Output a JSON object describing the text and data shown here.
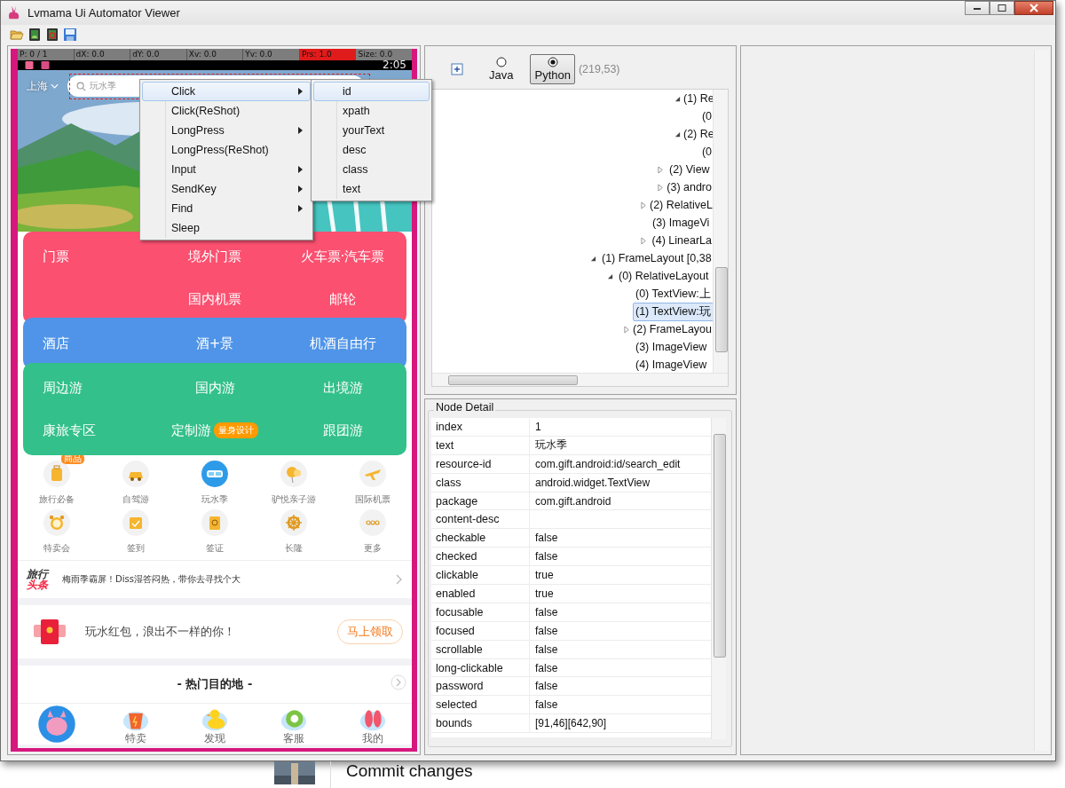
{
  "window": {
    "title": "Lvmama Ui Automator Viewer"
  },
  "phone": {
    "pointer_bar": [
      {
        "text": "P: 0 / 1",
        "alert": false
      },
      {
        "text": "dX: 0.0",
        "alert": false
      },
      {
        "text": "dY: 0.0",
        "alert": false
      },
      {
        "text": "Xv: 0.0",
        "alert": false
      },
      {
        "text": "Yv: 0.0",
        "alert": false
      },
      {
        "text": "Prs: 1.0",
        "alert": true
      },
      {
        "text": "Size: 0.0",
        "alert": false
      }
    ],
    "clock": "2:05",
    "city": "上海",
    "search_placeholder": "玩水季",
    "sections": [
      {
        "color": "#fb5070",
        "rows": [
          [
            {
              "label": "门票"
            },
            {
              "label": "境外门票"
            },
            {
              "label": "火车票·汽车票"
            }
          ],
          [
            {},
            {
              "label": "国内机票"
            },
            {
              "label": "邮轮"
            }
          ]
        ]
      },
      {
        "color": "#4f94e8",
        "rows": [
          [
            {
              "label": "酒店"
            },
            {
              "label": "酒+景"
            },
            {
              "label": "机酒自由行"
            }
          ]
        ]
      },
      {
        "color": "#33c08a",
        "rows": [
          [
            {
              "label": "周边游"
            },
            {
              "label": "国内游"
            },
            {
              "label": "出境游"
            }
          ],
          [
            {
              "label": "康旅专区"
            },
            {
              "label": "定制游",
              "badge": "量身设计"
            },
            {
              "label": "跟团游"
            }
          ]
        ]
      }
    ],
    "shortcuts": [
      {
        "label": "旅行必备",
        "badge": "商品"
      },
      {
        "label": "自驾游"
      },
      {
        "label": "玩水季"
      },
      {
        "label": "驴悦亲子游"
      },
      {
        "label": "国际机票"
      },
      {
        "label": "特卖会"
      },
      {
        "label": "签到"
      },
      {
        "label": "签证"
      },
      {
        "label": "长隆"
      },
      {
        "label": "更多"
      }
    ],
    "news": {
      "logo_top": "旅行",
      "logo_bottom": "头条",
      "headline": "梅雨季霸屏！Diss湿答闷热，带你去寻找个大"
    },
    "promo": {
      "text": "玩水红包，浪出不一样的你！",
      "button": "马上领取"
    },
    "hot": {
      "title": "- 热门目的地 -"
    },
    "nav": [
      {
        "selected": true
      },
      {
        "label": "特卖",
        "selected": false
      },
      {
        "label": "发现",
        "selected": false
      },
      {
        "label": "客服",
        "selected": false
      },
      {
        "label": "我的",
        "selected": false
      }
    ]
  },
  "context_menu": {
    "items": [
      {
        "label": "Click",
        "submenu": true,
        "selected": true
      },
      {
        "label": "Click(ReShot)",
        "submenu": false,
        "selected": false
      },
      {
        "label": "LongPress",
        "submenu": true,
        "selected": false
      },
      {
        "label": "LongPress(ReShot)",
        "submenu": false,
        "selected": false
      },
      {
        "label": "Input",
        "submenu": true,
        "selected": false
      },
      {
        "label": "SendKey",
        "submenu": true,
        "selected": false
      },
      {
        "label": "Find",
        "submenu": true,
        "selected": false
      },
      {
        "label": "Sleep",
        "submenu": false,
        "selected": false
      }
    ],
    "submenu": [
      {
        "label": "id",
        "selected": true
      },
      {
        "label": "xpath",
        "selected": false
      },
      {
        "label": "yourText",
        "selected": false
      },
      {
        "label": "desc",
        "selected": false
      },
      {
        "label": "class",
        "selected": false
      },
      {
        "label": "text",
        "selected": false
      }
    ]
  },
  "hierarchy": {
    "languages": [
      {
        "label": "Java",
        "selected": false
      },
      {
        "label": "Python",
        "selected": true
      }
    ],
    "coordinates": "(219,53)",
    "tree": [
      {
        "children": [
          {
            "children": [
              {
                "children": [
                  {
                    "children": [
                      {
                        "children": [
                          {
                            "label": "(1) Re",
                            "expanded": true,
                            "selected": false,
                            "children": [
                              {
                                "label": "(0",
                                "selected": false
                              }
                            ]
                          },
                          {
                            "label": "(2) Re",
                            "expanded": true,
                            "selected": false,
                            "children": [
                              {
                                "label": "(0",
                                "selected": false
                              }
                            ]
                          }
                        ]
                      },
                      {
                        "label": "(2) View",
                        "expanded": false,
                        "selected": false
                      },
                      {
                        "label": "(3) andro",
                        "expanded": false,
                        "selected": false
                      }
                    ]
                  },
                  {
                    "label": "(2) RelativeL",
                    "expanded": false,
                    "selected": false
                  },
                  {
                    "label": "(3) ImageVi",
                    "selected": false
                  },
                  {
                    "label": "(4) LinearLa",
                    "expanded": false,
                    "selected": false
                  }
                ]
              }
            ]
          }
        ]
      },
      {
        "label": "(1) FrameLayout [0,38",
        "expanded": true,
        "selected": false,
        "children": [
          {
            "label": "(0) RelativeLayout",
            "expanded": true,
            "selected": false,
            "children": [
              {
                "label": "(0) TextView:上",
                "selected": false
              },
              {
                "label": "(1) TextView:玩",
                "selected": true
              },
              {
                "label": "(2) FrameLayou",
                "expanded": false,
                "selected": false
              },
              {
                "label": "(3) ImageView",
                "selected": false
              },
              {
                "label": "(4) ImageView",
                "selected": false
              }
            ]
          }
        ]
      }
    ]
  },
  "node_detail": {
    "title": "Node Detail",
    "rows": [
      {
        "key": "index",
        "value": "1"
      },
      {
        "key": "text",
        "value": "玩水季"
      },
      {
        "key": "resource-id",
        "value": "com.gift.android:id/search_edit"
      },
      {
        "key": "class",
        "value": "android.widget.TextView"
      },
      {
        "key": "package",
        "value": "com.gift.android"
      },
      {
        "key": "content-desc"
      },
      {
        "key": "checkable",
        "value": "false"
      },
      {
        "key": "checked",
        "value": "false"
      },
      {
        "key": "clickable",
        "value": "true"
      },
      {
        "key": "enabled",
        "value": "true"
      },
      {
        "key": "focusable",
        "value": "false"
      },
      {
        "key": "focused",
        "value": "false"
      },
      {
        "key": "scrollable",
        "value": "false"
      },
      {
        "key": "long-clickable",
        "value": "false"
      },
      {
        "key": "password",
        "value": "false"
      },
      {
        "key": "selected",
        "value": "false"
      },
      {
        "key": "bounds",
        "value": "[91,46][642,90]"
      }
    ]
  },
  "footer": {
    "text": "Commit changes"
  }
}
